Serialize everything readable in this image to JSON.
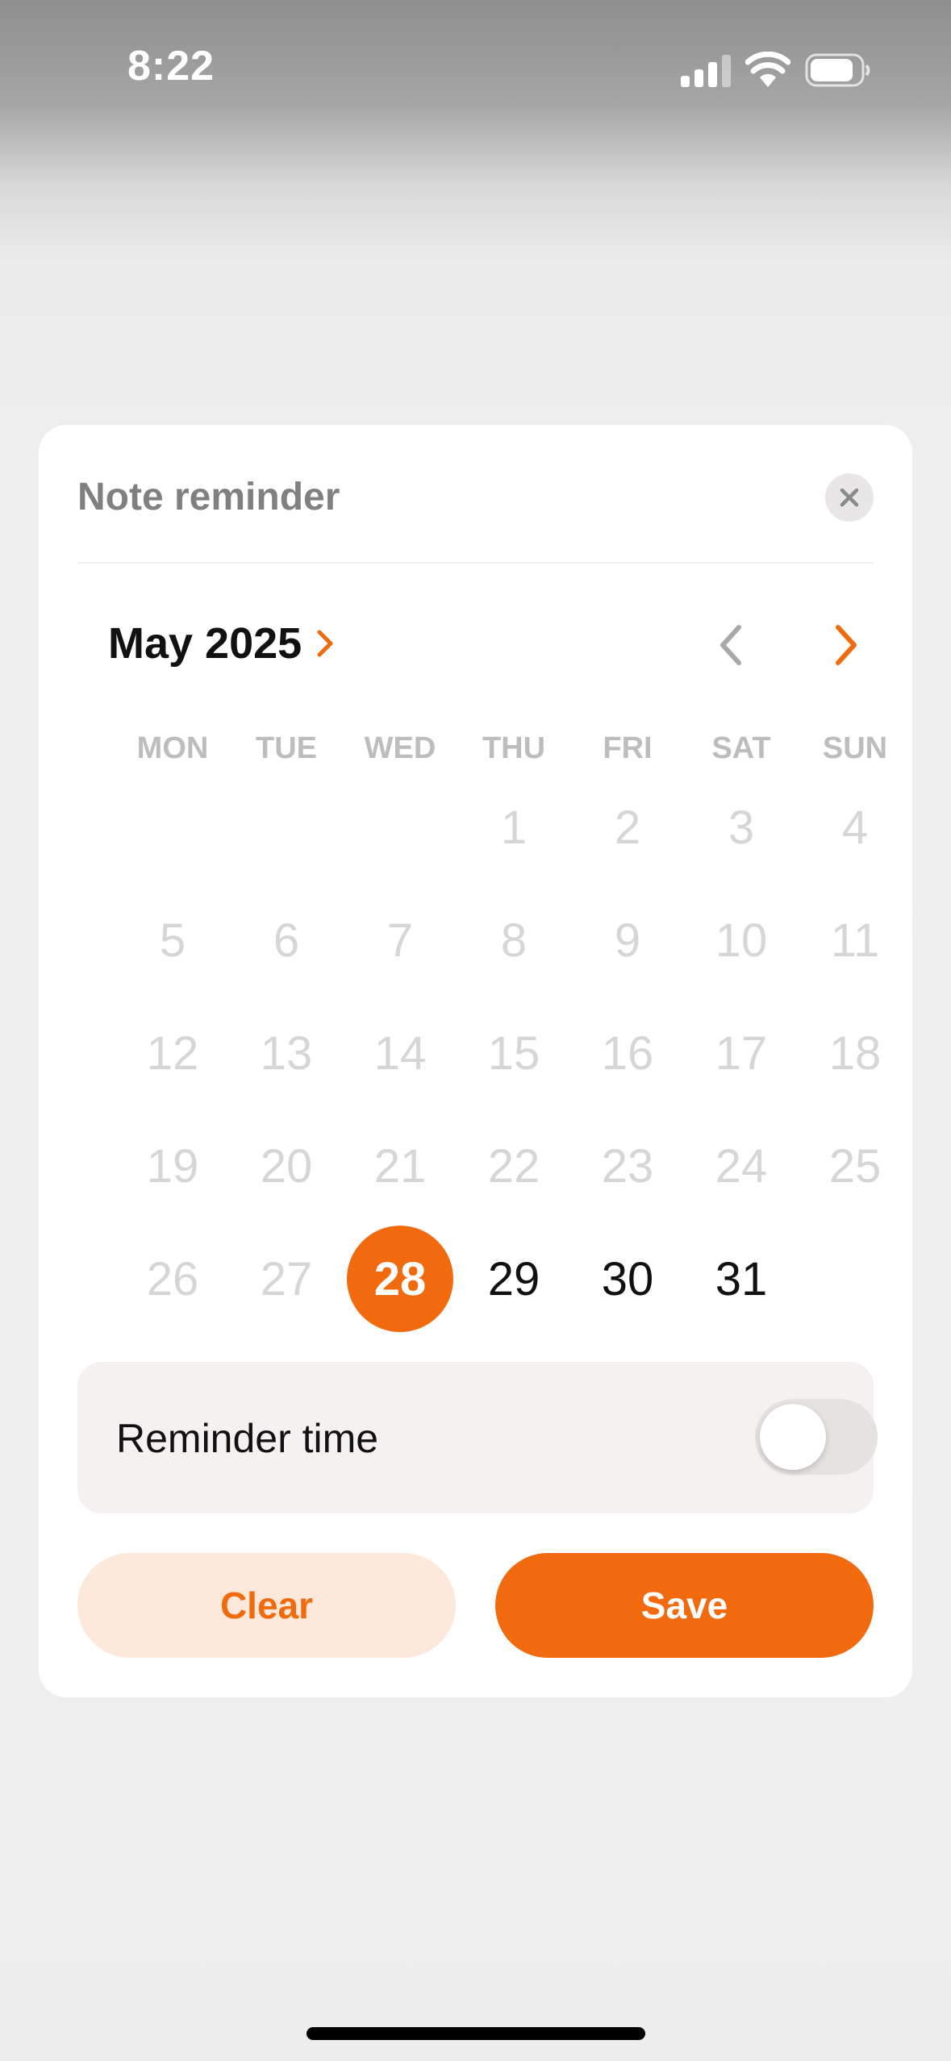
{
  "status_bar": {
    "time": "8:22",
    "icons": [
      "signal-icon",
      "wifi-icon",
      "battery-icon"
    ]
  },
  "dialog": {
    "title": "Note reminder",
    "close_icon": "close-icon"
  },
  "calendar": {
    "month_label": "May 2025",
    "weekdays": [
      "MON",
      "TUE",
      "WED",
      "THU",
      "FRI",
      "SAT",
      "SUN"
    ],
    "weeks": [
      [
        "",
        "",
        "",
        "1",
        "2",
        "3",
        "4"
      ],
      [
        "5",
        "6",
        "7",
        "8",
        "9",
        "10",
        "11"
      ],
      [
        "12",
        "13",
        "14",
        "15",
        "16",
        "17",
        "18"
      ],
      [
        "19",
        "20",
        "21",
        "22",
        "23",
        "24",
        "25"
      ],
      [
        "26",
        "27",
        "28",
        "29",
        "30",
        "31",
        ""
      ]
    ],
    "selected_day": "28",
    "disabled_days": [
      "1",
      "2",
      "3",
      "4",
      "5",
      "6",
      "7",
      "8",
      "9",
      "10",
      "11",
      "12",
      "13",
      "14",
      "15",
      "16",
      "17",
      "18",
      "19",
      "20",
      "21",
      "22",
      "23",
      "24",
      "25",
      "26",
      "27"
    ]
  },
  "reminder_time": {
    "label": "Reminder time",
    "enabled": false
  },
  "actions": {
    "clear_label": "Clear",
    "save_label": "Save"
  },
  "colors": {
    "accent": "#f26a0e",
    "accent_light": "#fde8dc",
    "disabled_text": "#d6d6d6",
    "weekday_text": "#bdbdbd"
  }
}
